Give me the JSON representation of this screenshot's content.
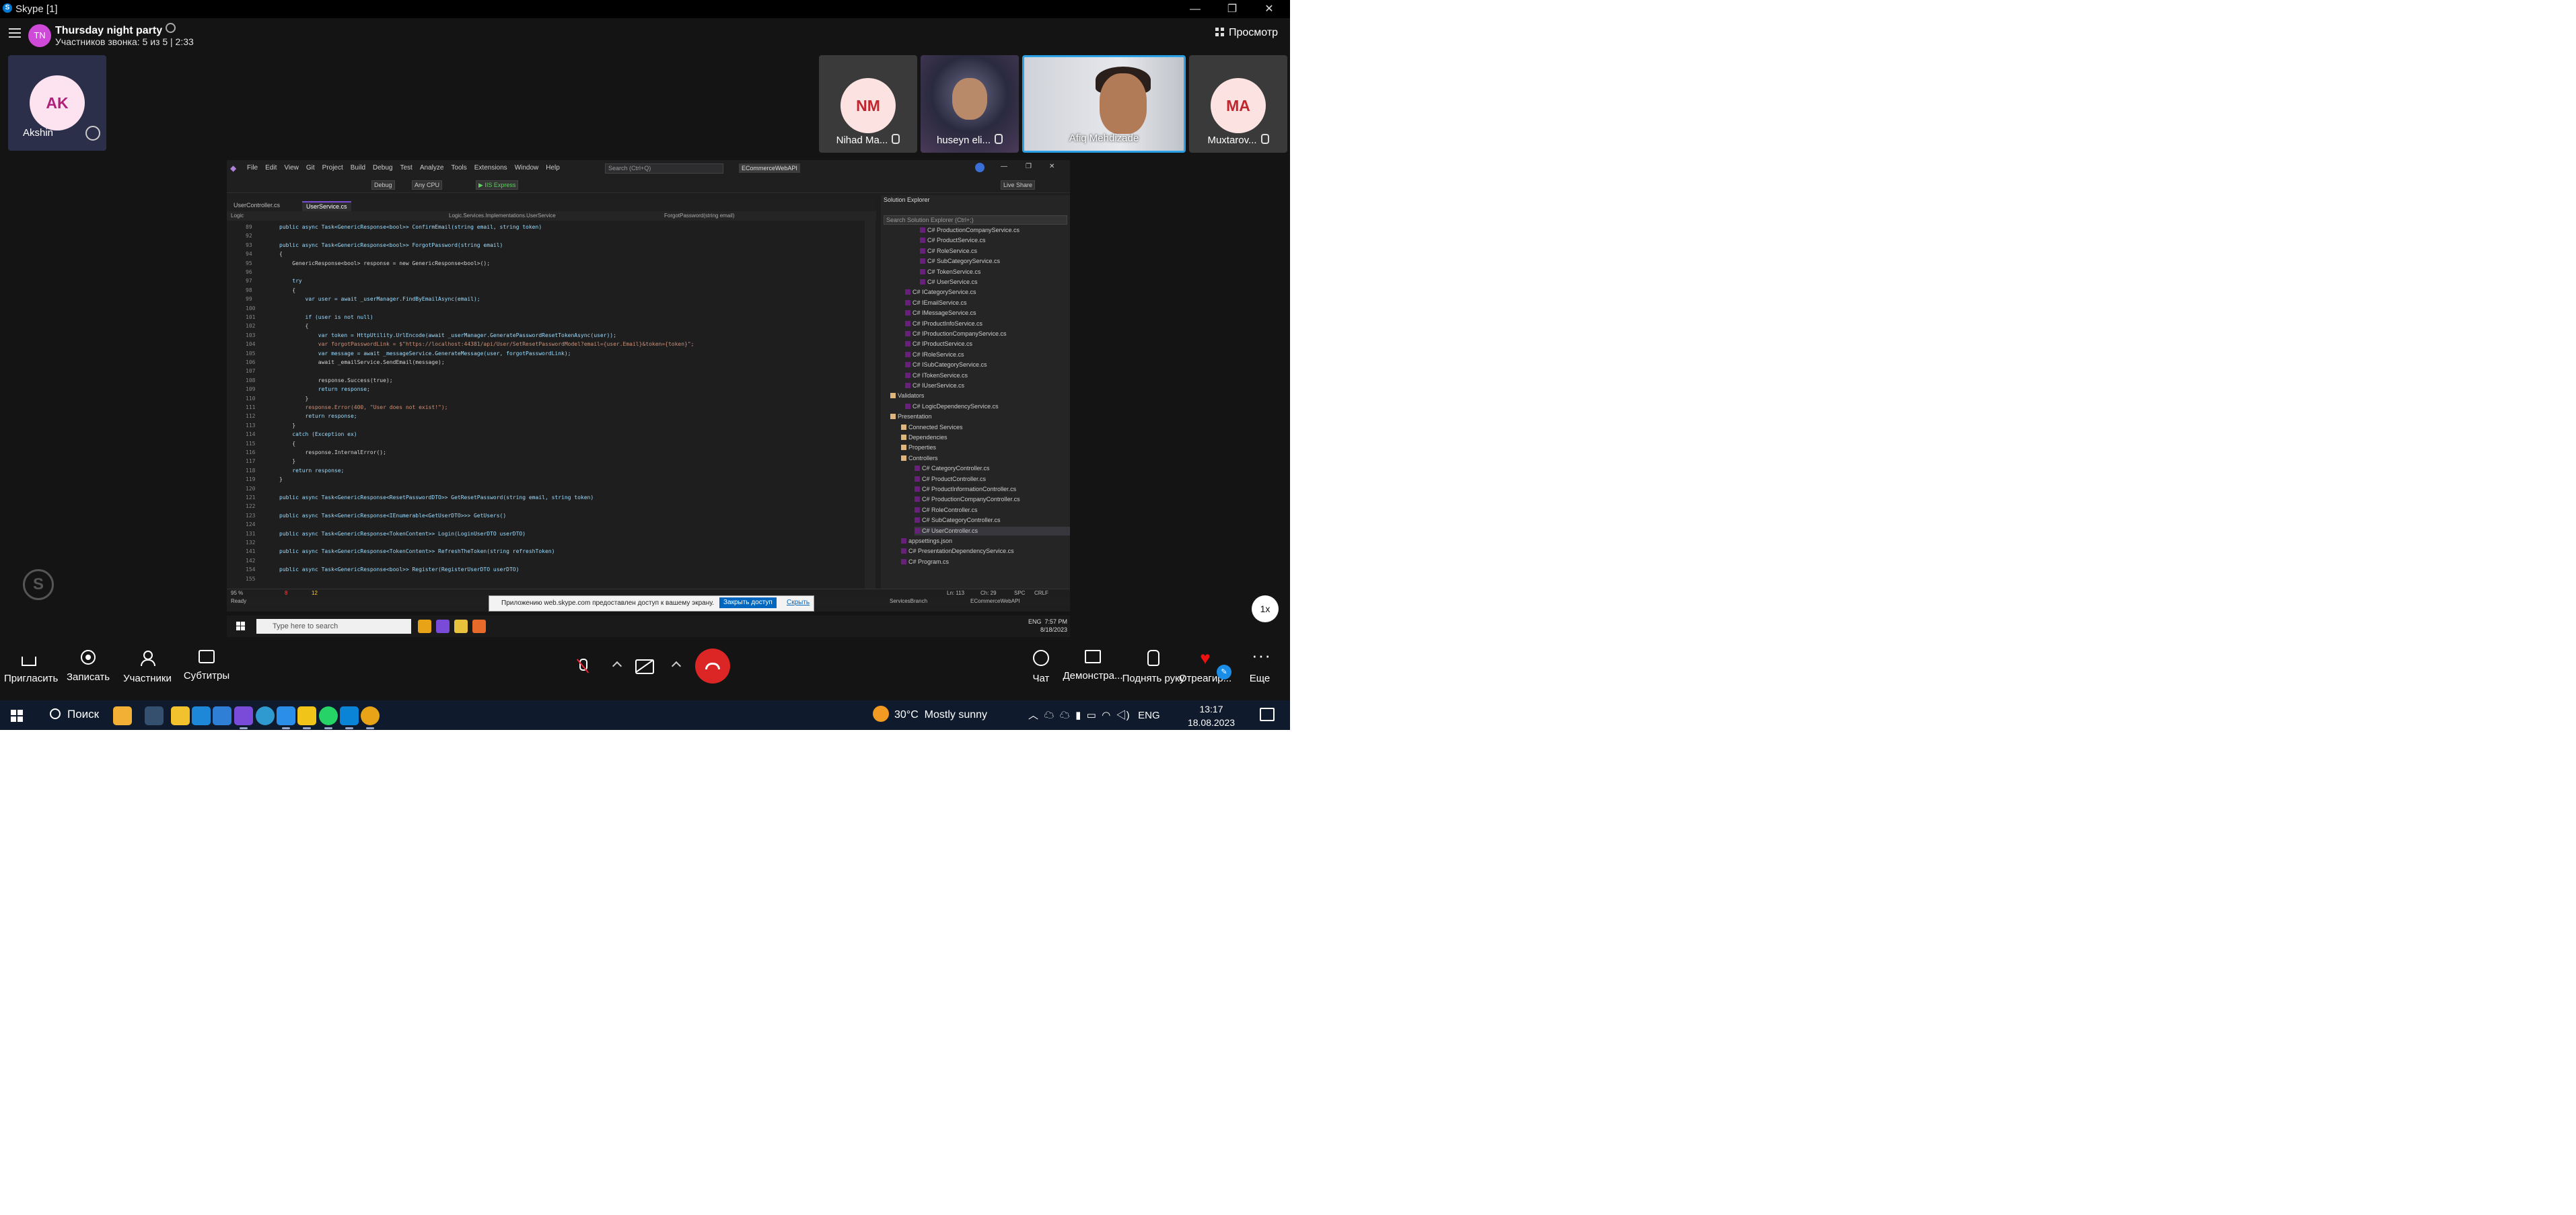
{
  "window": {
    "title": "Skype [1]",
    "minimize": "—",
    "maximize": "❐",
    "close": "✕"
  },
  "header": {
    "call_title": "Thursday night party",
    "call_subtitle": "Участников звонка: 5 из 5 | 2:33",
    "view_button": "Просмотр"
  },
  "self_tile": {
    "initials": "AK",
    "name": "Akshin"
  },
  "participants": [
    {
      "initials": "NM",
      "name": "Nihad Ma..."
    },
    {
      "initials": "",
      "name": "huseyn eli..."
    },
    {
      "initials": "",
      "name": "Afiq Mehdizade"
    },
    {
      "initials": "MA",
      "name": "Muxtarov..."
    }
  ],
  "shared_screen": {
    "menu": [
      "File",
      "Edit",
      "View",
      "Git",
      "Project",
      "Build",
      "Debug",
      "Test",
      "Analyze",
      "Tools",
      "Extensions",
      "Window",
      "Help"
    ],
    "search_placeholder": "Search (Ctrl+Q)",
    "project_badge": "ECommerceWebAPI",
    "toolbar": {
      "config": "Debug",
      "platform": "Any CPU",
      "run": "▶ IIS Express",
      "live_share": "Live Share"
    },
    "tabs": [
      "UserController.cs",
      "UserService.cs"
    ],
    "nav": {
      "project": "Logic",
      "class": "Logic.Services.Implementations.UserService",
      "member": "ForgotPassword(string email)"
    },
    "line_numbers": [
      "89",
      "92",
      "93",
      "94",
      "95",
      "96",
      "97",
      "98",
      "99",
      "100",
      "101",
      "102",
      "103",
      "104",
      "105",
      "106",
      "107",
      "108",
      "109",
      "110",
      "111",
      "112",
      "113",
      "114",
      "115",
      "116",
      "117",
      "118",
      "119",
      "120",
      "121",
      "122",
      "123",
      "124",
      "131",
      "132",
      "141",
      "142",
      "154",
      "155"
    ],
    "code_lines": [
      "public async Task<GenericResponse<bool>> ConfirmEmail(string email, string token)",
      "",
      "public async Task<GenericResponse<bool>> ForgotPassword(string email)",
      "{",
      "    GenericResponse<bool> response = new GenericResponse<bool>();",
      "",
      "    try",
      "    {",
      "        var user = await _userManager.FindByEmailAsync(email);",
      "",
      "        if (user is not null)",
      "        {",
      "            var token = HttpUtility.UrlEncode(await _userManager.GeneratePasswordResetTokenAsync(user));",
      "            var forgotPasswordLink = $\"https://localhost:44381/api/User/SetResetPasswordModel?email={user.Email}&token={token}\";",
      "            var message = await _messageService.GenerateMessage(user, forgotPasswordLink);",
      "            await _emailService.SendEmail(message);",
      "",
      "            response.Success(true);",
      "            return response;",
      "        }",
      "        response.Error(400, \"User does not exist!\");",
      "        return response;",
      "    }",
      "    catch (Exception ex)",
      "    {",
      "        response.InternalError();",
      "    }",
      "    return response;",
      "}",
      "",
      "public async Task<GenericResponse<ResetPasswordDTO>> GetResetPassword(string email, string token)",
      "",
      "public async Task<GenericResponse<IEnumerable<GetUserDTO>>> GetUsers()",
      "",
      "public async Task<GenericResponse<TokenContent>> Login(LoginUserDTO userDTO)",
      "",
      "public async Task<GenericResponse<TokenContent>> RefreshTheToken(string refreshToken)",
      "",
      "public async Task<GenericResponse<bool>> Register(RegisterUserDTO userDTO)",
      ""
    ],
    "solution_explorer": {
      "title": "Solution Explorer",
      "search_placeholder": "Search Solution Explorer (Ctrl+;)",
      "items": [
        "C# ProductionCompanyService.cs",
        "C# ProductService.cs",
        "C# RoleService.cs",
        "C# SubCategoryService.cs",
        "C# TokenService.cs",
        "C# UserService.cs",
        "C# ICategoryService.cs",
        "C# IEmailService.cs",
        "C# IMessageService.cs",
        "C# IProductInfoService.cs",
        "C# IProductionCompanyService.cs",
        "C# IProductService.cs",
        "C# IRoleService.cs",
        "C# ISubCategoryService.cs",
        "C# ITokenService.cs",
        "C# IUserService.cs",
        "Validators",
        "C# LogicDependencyService.cs",
        "Presentation",
        "Connected Services",
        "Dependencies",
        "Properties",
        "Controllers",
        "C# CategoryController.cs",
        "C# ProductController.cs",
        "C# ProductInformationController.cs",
        "C# ProductionCompanyController.cs",
        "C# RoleController.cs",
        "C# SubCategoryController.cs",
        "C# UserController.cs",
        "appsettings.json",
        "C# PresentationDependencyService.cs",
        "C# Program.cs"
      ]
    },
    "status": {
      "zoom": "95 %",
      "errors": "8",
      "warnings": "12",
      "ln": "Ln: 113",
      "col": "Ch: 29",
      "spc": "SPC",
      "crlf": "CRLF"
    },
    "bar": {
      "ready": "Ready",
      "branch": "ServicesBranch",
      "repo": "ECommerceWebAPI"
    },
    "infobar": {
      "text": "Приложению web.skype.com предоставлен доступ к вашему экрану.",
      "stop_button": "Закрыть доступ",
      "hide_link": "Скрыть"
    },
    "inner_taskbar": {
      "search_placeholder": "Type here to search",
      "lang": "ENG",
      "time": "7:57 PM",
      "date": "8/18/2023"
    }
  },
  "speed_button": "1x",
  "controls": {
    "invite": "Пригласить",
    "record": "Записать",
    "participants": "Участники",
    "subtitles": "Субтитры",
    "chat": "Чат",
    "share": "Демонстра...",
    "raise_hand": "Поднять руку",
    "react": "Отреагир...",
    "more": "Еще"
  },
  "taskbar": {
    "search": "Поиск",
    "temperature": "30°C",
    "weather": "Mostly sunny",
    "lang": "ENG",
    "time": "13:17",
    "date": "18.08.2023"
  },
  "colors": {
    "background": "#141414",
    "accent": "#2aa0e6",
    "hangup": "#dc2626",
    "taskbar": "#0f1a2c"
  }
}
